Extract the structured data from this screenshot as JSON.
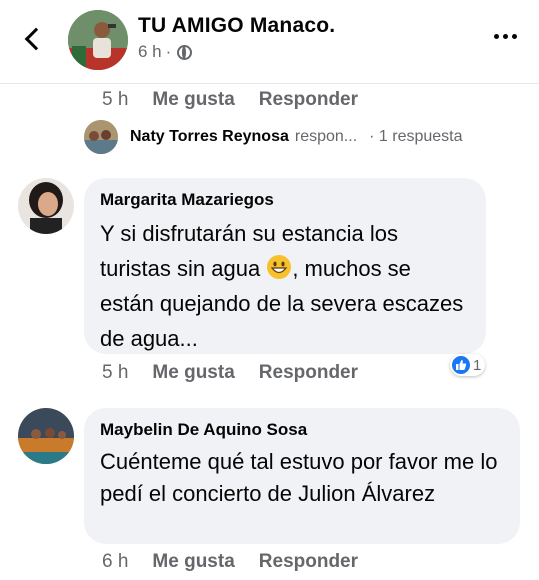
{
  "header": {
    "author": "TU AMIGO Manaco.",
    "time": "6 h",
    "separator": "·",
    "privacy_icon": "globe-icon"
  },
  "top_actions": {
    "time": "5 h",
    "like": "Me gusta",
    "reply": "Responder"
  },
  "reply_summary": {
    "name": "Naty Torres Reynosa",
    "verb": "respon...",
    "count": "· 1 respuesta"
  },
  "comments": [
    {
      "author": "Margarita Mazariegos",
      "text_before_emoji": "Y si disfrutarán su estancia los turistas sin agua ",
      "emoji": "grinning-face-emoji",
      "text_after_emoji": ", muchos se están quejando de la severa escazes de agua...",
      "time": "5 h",
      "like": "Me gusta",
      "reply": "Responder",
      "reaction_count": "1"
    },
    {
      "author": "Maybelin De Aquino Sosa",
      "text": "Cuénteme qué tal estuvo por favor me lo pedí el concierto de Julion Álvarez",
      "time": "6 h",
      "like": "Me gusta",
      "reply": "Responder"
    }
  ],
  "colors": {
    "bubble": "#f0f2f5",
    "secondary_text": "#65676b",
    "like_blue": "#1877f2"
  }
}
